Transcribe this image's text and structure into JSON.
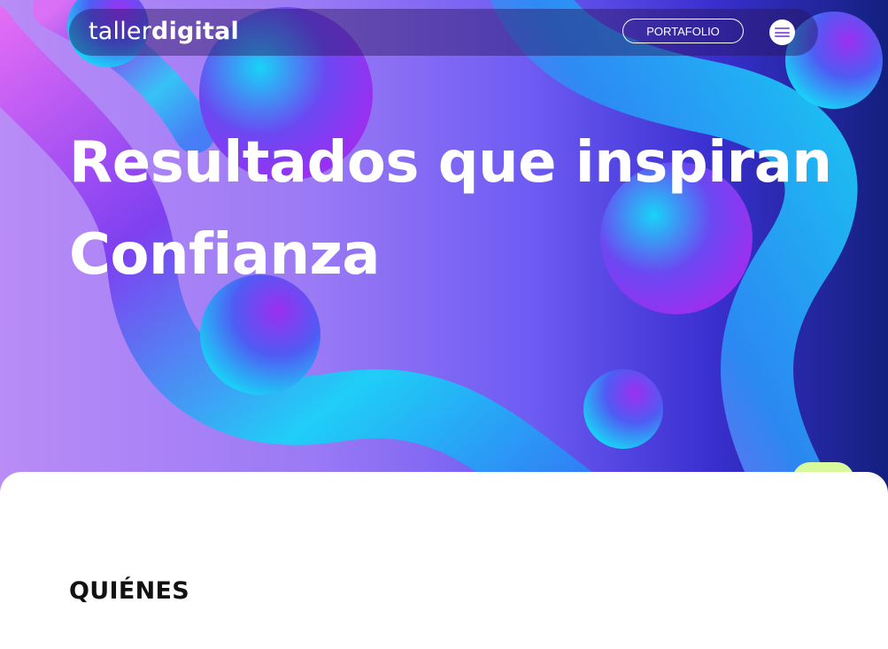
{
  "brand": {
    "logo_light": "taller",
    "logo_bold": "digital"
  },
  "nav": {
    "portfolio_label": "PORTAFOLIO",
    "menu_icon": "hamburger-menu-icon"
  },
  "hero": {
    "headline_line1": "Resultados que inspiran",
    "headline_line2": "Confianza"
  },
  "section": {
    "title": "QUIÉNES"
  },
  "colors": {
    "gradient_start": "#b98cf6",
    "gradient_end": "#13207e",
    "accent_cyan": "#19d3f7",
    "accent_magenta": "#d84cf3",
    "accent_green": "#d9f99d"
  }
}
